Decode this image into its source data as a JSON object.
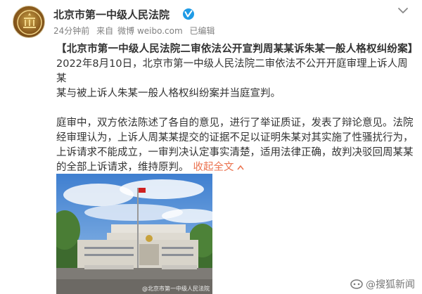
{
  "account": {
    "name": "北京市第一中级人民法院"
  },
  "meta": {
    "time": "24分钟前",
    "source_prefix": "来自",
    "source": "微博 weibo.com",
    "edited": "已编辑"
  },
  "post": {
    "title": "【北京市第一中级人民法院二审依法公开宣判周某某诉朱某一般人格权纠纷案】",
    "para1_line1": "2022年8月10日，北京市第一中级人民法院二审依法不公开开庭审理上诉人周某",
    "para1_line2": "某与被上诉人朱某一般人格权纠纷案并当庭宣判。",
    "para2_line1": "庭审中，双方依法陈述了各自的意见，进行了举证质证，发表了辩论意见。法院",
    "para2_line2": "经审理认为，上诉人周某某提交的证据不足以证明朱某对其实施了性骚扰行为，",
    "para2_line3": "上诉请求不能成立，一审判决认定事实清楚，适用法律正确，故判决驳回周某某",
    "para2_line4": "的全部上诉请求，维持原判。",
    "collapse_label": "收起全文"
  },
  "photo": {
    "watermark": "@北京市第一中级人民法院"
  },
  "page_watermark": "@搜狐新闻",
  "colors": {
    "link": "#eb7350",
    "verified": "#1f9be6",
    "meta": "#808080"
  }
}
